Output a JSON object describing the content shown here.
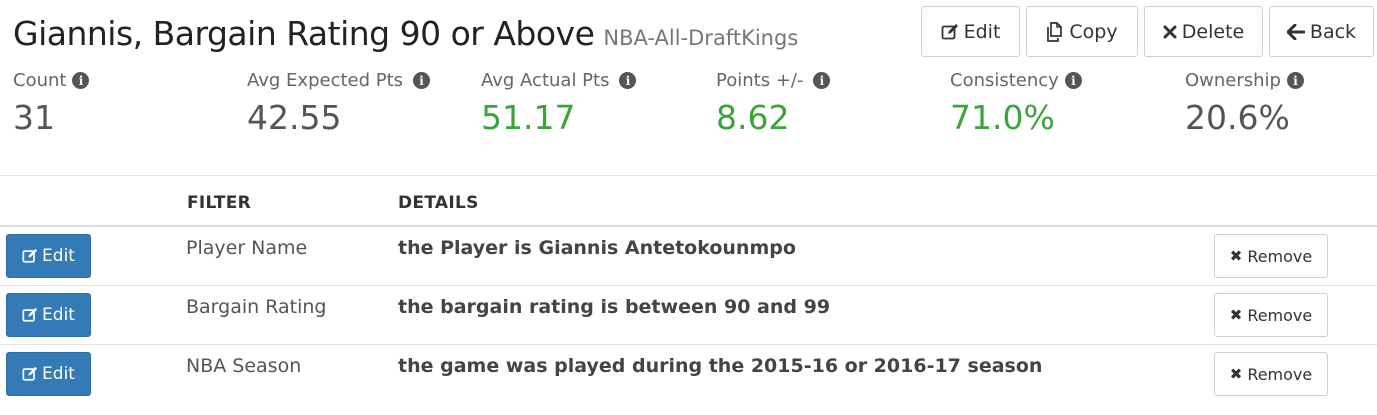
{
  "header": {
    "title": "Giannis, Bargain Rating 90 or Above",
    "subtitle": "NBA-All-DraftKings",
    "buttons": {
      "edit": "Edit",
      "copy": "Copy",
      "delete": "Delete",
      "back": "Back"
    }
  },
  "stats": [
    {
      "label": "Count",
      "value": "31",
      "color": "#555555"
    },
    {
      "label": "Avg Expected Pts",
      "value": "42.55",
      "color": "#555555"
    },
    {
      "label": "Avg Actual Pts",
      "value": "51.17",
      "color": "#3aa63a"
    },
    {
      "label": "Points +/-",
      "value": "8.62",
      "color": "#3aa63a"
    },
    {
      "label": "Consistency",
      "value": "71.0%",
      "color": "#3aa63a"
    },
    {
      "label": "Ownership",
      "value": "20.6%",
      "color": "#555555"
    }
  ],
  "table": {
    "headers": {
      "filter": "FILTER",
      "details": "DETAILS"
    },
    "rows": [
      {
        "edit_label": "Edit",
        "filter": "Player Name",
        "details": "the Player is Giannis Antetokounmpo",
        "remove_label": "Remove"
      },
      {
        "edit_label": "Edit",
        "filter": "Bargain Rating",
        "details": "the bargain rating is between 90 and 99",
        "remove_label": "Remove"
      },
      {
        "edit_label": "Edit",
        "filter": "NBA Season",
        "details": "the game was played during the 2015-16 or 2016-17 season",
        "remove_label": "Remove"
      }
    ]
  },
  "colors": {
    "primary_button": "#337ab7",
    "positive": "#3aa63a"
  }
}
